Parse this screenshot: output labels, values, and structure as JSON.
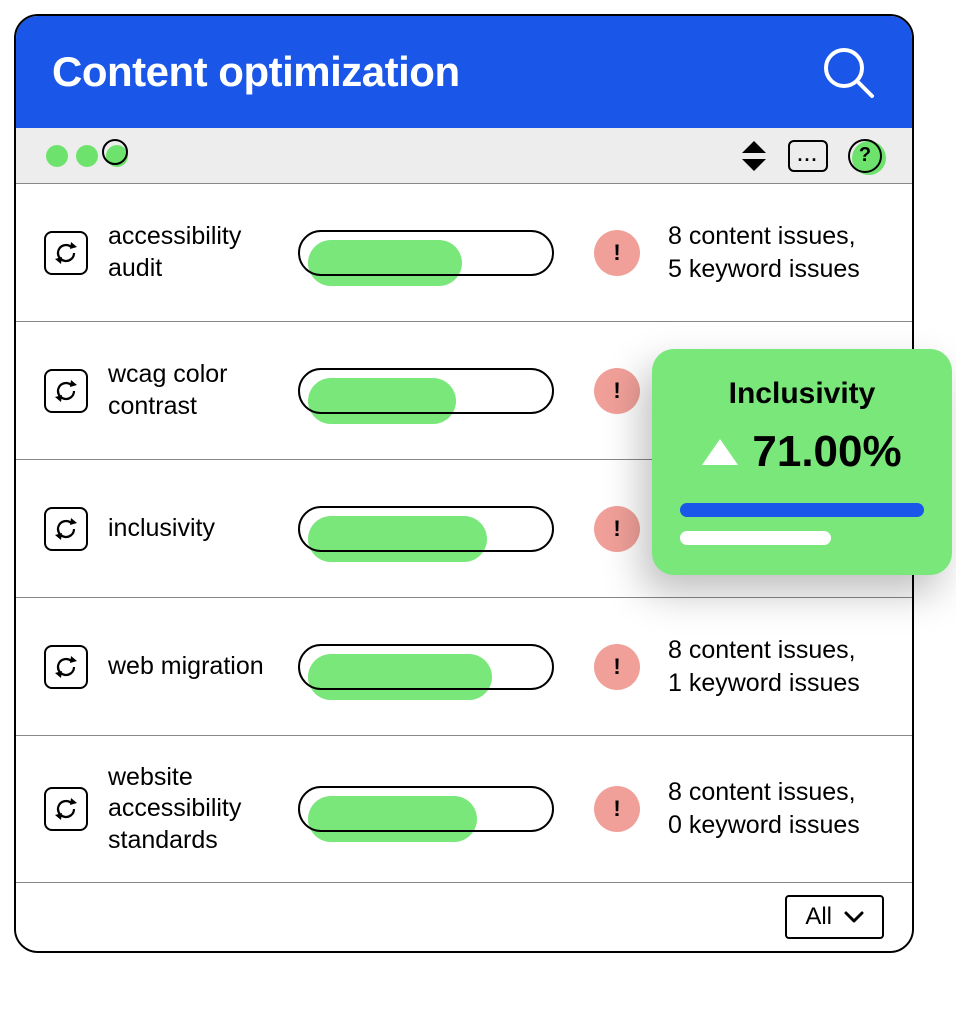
{
  "header": {
    "title": "Content optimization"
  },
  "toolbar": {
    "more_label": "...",
    "help_label": "?"
  },
  "rows": [
    {
      "label": "accessibility audit",
      "progress_pct": 60,
      "issues_line1": "8 content issues,",
      "issues_line2": "5 keyword issues"
    },
    {
      "label": "wcag color contrast",
      "progress_pct": 58,
      "issues_line1": "",
      "issues_line2": ""
    },
    {
      "label": "inclusivity",
      "progress_pct": 70,
      "issues_line1": "",
      "issues_line2": ""
    },
    {
      "label": "web migration",
      "progress_pct": 72,
      "issues_line1": "8 content issues,",
      "issues_line2": "1 keyword issues"
    },
    {
      "label": "website accessibility standards",
      "progress_pct": 66,
      "issues_line1": "8 content issues,",
      "issues_line2": "0 keyword issues"
    }
  ],
  "footer": {
    "filter_label": "All"
  },
  "popup": {
    "title": "Inclusivity",
    "value": "71.00%"
  },
  "colors": {
    "brand_blue": "#1a56e8",
    "accent_green": "#79e779",
    "warn": "#f1a099"
  }
}
